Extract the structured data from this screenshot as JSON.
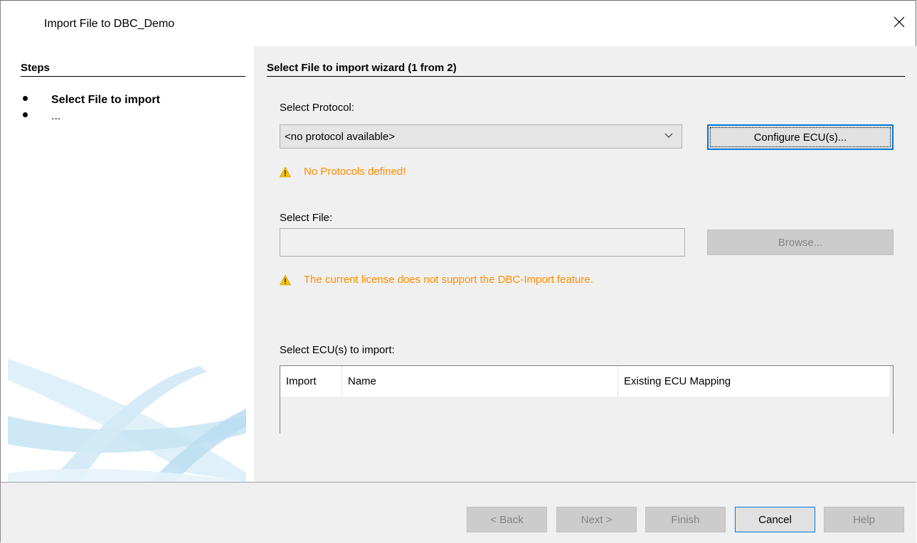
{
  "window": {
    "title": "Import File to DBC_Demo"
  },
  "steps": {
    "heading": "Steps",
    "items": [
      {
        "label": "Select File to import"
      },
      {
        "label": "..."
      }
    ]
  },
  "wizard": {
    "title": "Select File to import wizard (1 from 2)",
    "protocol": {
      "label": "Select Protocol:",
      "selected": "<no protocol available>",
      "configure_button": "Configure ECU(s)...",
      "warning": "No Protocols defined!"
    },
    "file": {
      "label": "Select File:",
      "value": "",
      "browse_button": "Browse...",
      "warning": "The current license does not support the DBC-Import feature."
    },
    "ecu": {
      "label": "Select ECU(s) to import:",
      "columns": [
        "Import",
        "Name",
        "Existing ECU Mapping"
      ]
    }
  },
  "footer": {
    "back": "< Back",
    "next": "Next >",
    "finish": "Finish",
    "cancel": "Cancel",
    "help": "Help"
  },
  "colors": {
    "warning_text": "#ff8c00",
    "focus_border": "#0078d7",
    "panel_bg": "#f0f0f0"
  }
}
